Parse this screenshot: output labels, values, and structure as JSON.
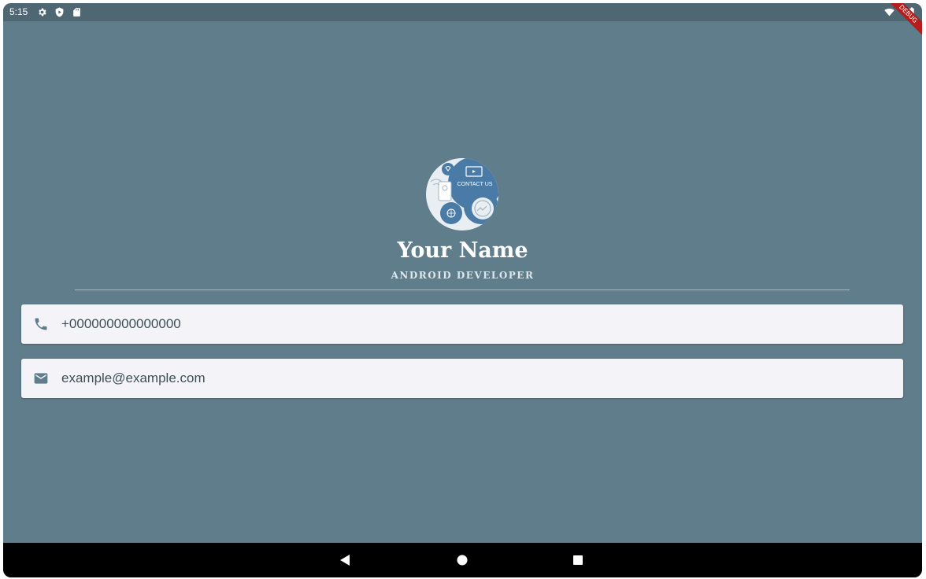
{
  "status_bar": {
    "time": "5:15",
    "icons": [
      "settings-icon",
      "shield-icon",
      "sd-card-icon",
      "wifi-icon",
      "battery-icon"
    ]
  },
  "debug_banner": {
    "label": "DEBUG"
  },
  "profile": {
    "avatar_text": "CONTACT US",
    "name": "Your Name",
    "title": "ANDROID DEVELOPER"
  },
  "contacts": {
    "phone": {
      "icon": "phone-icon",
      "value": "+000000000000000"
    },
    "email": {
      "icon": "mail-icon",
      "value": "example@example.com"
    }
  },
  "nav_bar": {
    "buttons": [
      "back",
      "home",
      "recents"
    ]
  },
  "colors": {
    "background": "#607d8b",
    "status_bar": "#4f6772",
    "card": "#f4f4f8",
    "card_text": "#3d4f58",
    "icon": "#607d8b"
  }
}
